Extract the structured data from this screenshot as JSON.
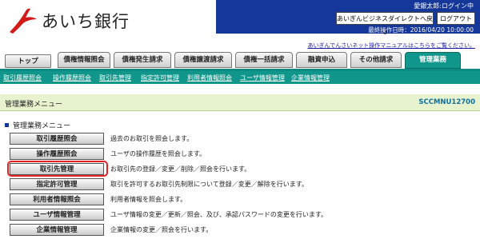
{
  "brand": {
    "name": "あいち銀行"
  },
  "topbar": {
    "user_info": "愛銀太郎:ログイン中",
    "business_direct_button": "あいぎんビジネスダイレクトへ戻る",
    "logout_button": "ログアウト",
    "last_operation": "最終操作日時：2016/04/20 10:00:00"
  },
  "manual_link": "あいぎんでんさいネット操作マニュアルはこちらをご覧ください。",
  "tabs": [
    {
      "label": "トップ"
    },
    {
      "label": "債権情報照会"
    },
    {
      "label": "債権発生請求"
    },
    {
      "label": "債権譲渡請求"
    },
    {
      "label": "債権一括請求"
    },
    {
      "label": "融資申込"
    },
    {
      "label": "その他請求"
    },
    {
      "label": "管理業務"
    }
  ],
  "subnav": [
    {
      "label": "取引履歴照会"
    },
    {
      "label": "操作履歴照会"
    },
    {
      "label": "取引先管理"
    },
    {
      "label": "指定許可管理"
    },
    {
      "label": "利用者情報照会"
    },
    {
      "label": "ユーザ情報管理"
    },
    {
      "label": "企業情報管理"
    }
  ],
  "screen": {
    "title": "管理業務メニュー",
    "id": "SCCMNU12700"
  },
  "section": {
    "title": "管理業務メニュー"
  },
  "menu": [
    {
      "label": "取引履歴照会",
      "desc": "過去のお取引を照会します。"
    },
    {
      "label": "操作履歴照会",
      "desc": "ユーザの操作履歴を照会します。"
    },
    {
      "label": "取引先管理",
      "desc": "お取引先の登録／変更／削除／照会を行います。"
    },
    {
      "label": "指定許可管理",
      "desc": "取引を許可するお取引先制限について登録／変更／解除を行います。"
    },
    {
      "label": "利用者情報照会",
      "desc": "利用者情報を照会します。"
    },
    {
      "label": "ユーザ情報管理",
      "desc": "ユーザ情報の変更／更新／照会、及び、承認パスワードの変更を行います。"
    },
    {
      "label": "企業情報管理",
      "desc": "企業情報の変更／照会を行います。"
    }
  ],
  "colors": {
    "navy": "#15379a",
    "teal": "#10968b",
    "highlight": "#e52222",
    "logo_red": "#d21a1a"
  }
}
